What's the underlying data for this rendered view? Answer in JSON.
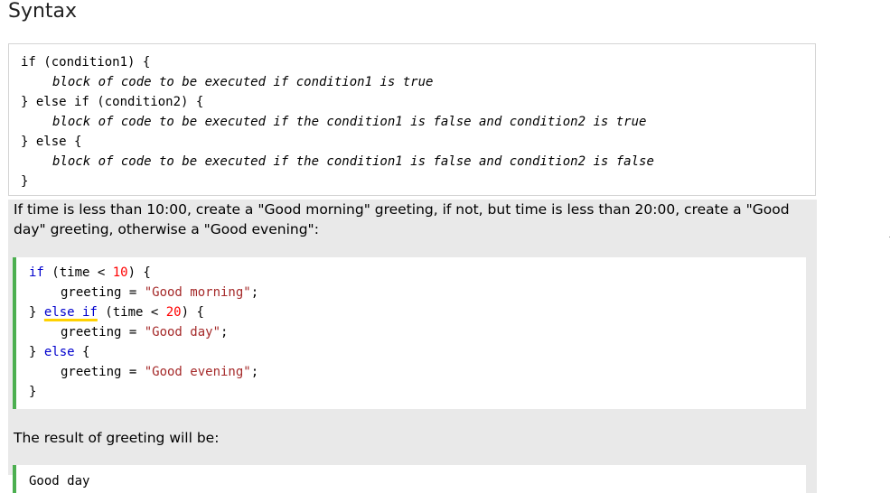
{
  "heading": "Syntax",
  "syntax": {
    "line1": "if (condition1) {",
    "line2": "block of code to be executed if condition1 is true",
    "line3": "} else if (condition2) {",
    "line4": "block of code to be executed if the condition1 is false and condition2 is true",
    "line5": "} else {",
    "line6": "block of code to be executed if the condition1 is false and condition2 is false",
    "line7": "}"
  },
  "description": "If time is less than 10:00, create a \"Good morning\" greeting, if not, but time is less than 20:00, create a \"Good day\" greeting, otherwise a \"Good evening\":",
  "example": {
    "if_kw": "if",
    "cond1_open": " (time < ",
    "num1": "10",
    "cond1_close": ") {",
    "var1": "greeting = ",
    "str1": "\"Good morning\"",
    "semi1": ";",
    "close_brace1": "} ",
    "else_if_kw": "else if",
    "cond2_open": " (time < ",
    "num2": "20",
    "cond2_close": ") {",
    "var2": "greeting = ",
    "str2": "\"Good day\"",
    "semi2": ";",
    "close_brace2": "} ",
    "else_kw": "else",
    "else_open": " {",
    "var3": "greeting = ",
    "str3": "\"Good evening\"",
    "semi3": ";",
    "close_brace3": "}"
  },
  "result_text": "The result of greeting will be:",
  "result_value": "Good day",
  "colors": {
    "accent_bar": "#4caf50",
    "keyword": "#0000cd",
    "number": "#ff0000",
    "string": "#a52a2a",
    "panel_bg": "#e9e9e9",
    "squiggle": "#ffd200"
  }
}
